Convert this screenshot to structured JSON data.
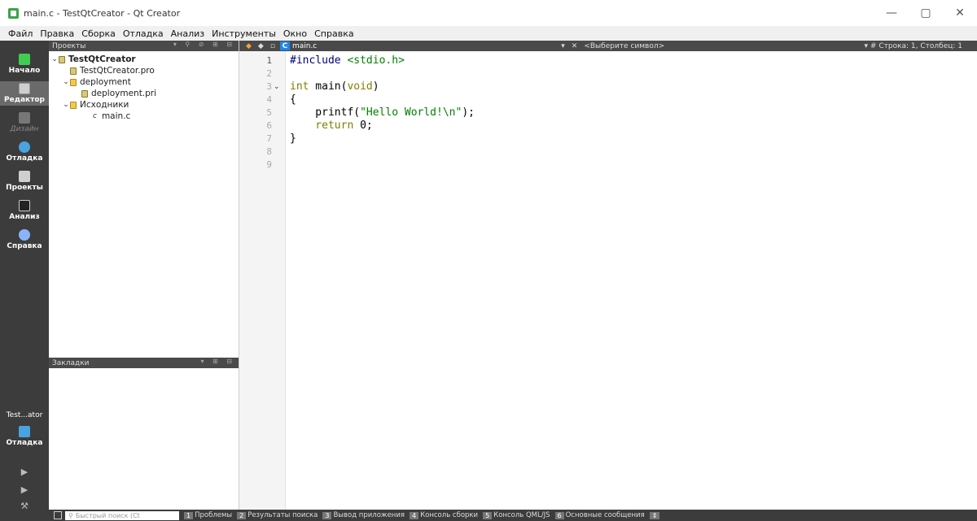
{
  "window": {
    "title": "main.c - TestQtCreator - Qt Creator"
  },
  "menu": [
    "Файл",
    "Правка",
    "Сборка",
    "Отладка",
    "Анализ",
    "Инструменты",
    "Окно",
    "Справка"
  ],
  "modes": [
    {
      "label": "Начало",
      "icon": "qt-logo-icon",
      "color": "#41cd52"
    },
    {
      "label": "Редактор",
      "icon": "editor-icon",
      "color": "#cfcfcf"
    },
    {
      "label": "Дизайн",
      "icon": "design-icon",
      "color": "#777777"
    },
    {
      "label": "Отладка",
      "icon": "debug-icon",
      "color": "#4aa3df"
    },
    {
      "label": "Проекты",
      "icon": "projects-icon",
      "color": "#cfcfcf"
    },
    {
      "label": "Анализ",
      "icon": "analyze-icon",
      "color": "#cfcfcf"
    },
    {
      "label": "Справка",
      "icon": "help-icon",
      "color": "#8ab4f8"
    }
  ],
  "kit": {
    "project": "Test...ator",
    "mode": "Отладка"
  },
  "projects_pane": {
    "title": "Проекты",
    "tree": [
      {
        "label": "TestQtCreator"
      },
      {
        "label": "TestQtCreator.pro"
      },
      {
        "label": "deployment"
      },
      {
        "label": "deployment.pri"
      },
      {
        "label": "Исходники"
      },
      {
        "label": "main.c"
      }
    ]
  },
  "bookmarks_pane": {
    "title": "Закладки"
  },
  "editor": {
    "file_tab": "main.c",
    "symbol_placeholder": "<Выберите символ>",
    "cursor_position": "Строка: 1, Столбец: 1",
    "line_numbers": [
      "1",
      "2",
      "3",
      "4",
      "5",
      "6",
      "7",
      "8",
      "9"
    ],
    "code": {
      "l1_pp": "#include",
      "l1_hdr": " <stdio.h>",
      "l3_kw": "int",
      "l3_rest": " main(",
      "l3_kw2": "void",
      "l3_end": ")",
      "l4": "{",
      "l5_fn": "    printf(",
      "l5_str": "\"Hello World!\\n\"",
      "l5_end": ");",
      "l6_kw": "    return",
      "l6_rest": " 0;",
      "l7": "}"
    }
  },
  "status_bar": {
    "locator_placeholder": "Быстрый поиск (Ct",
    "tabs": [
      {
        "num": "1",
        "label": "Проблемы"
      },
      {
        "num": "2",
        "label": "Результаты поиска"
      },
      {
        "num": "3",
        "label": "Вывод приложения"
      },
      {
        "num": "4",
        "label": "Консоль сборки"
      },
      {
        "num": "5",
        "label": "Консоль QML/JS"
      },
      {
        "num": "6",
        "label": "Основные сообщения"
      }
    ]
  }
}
